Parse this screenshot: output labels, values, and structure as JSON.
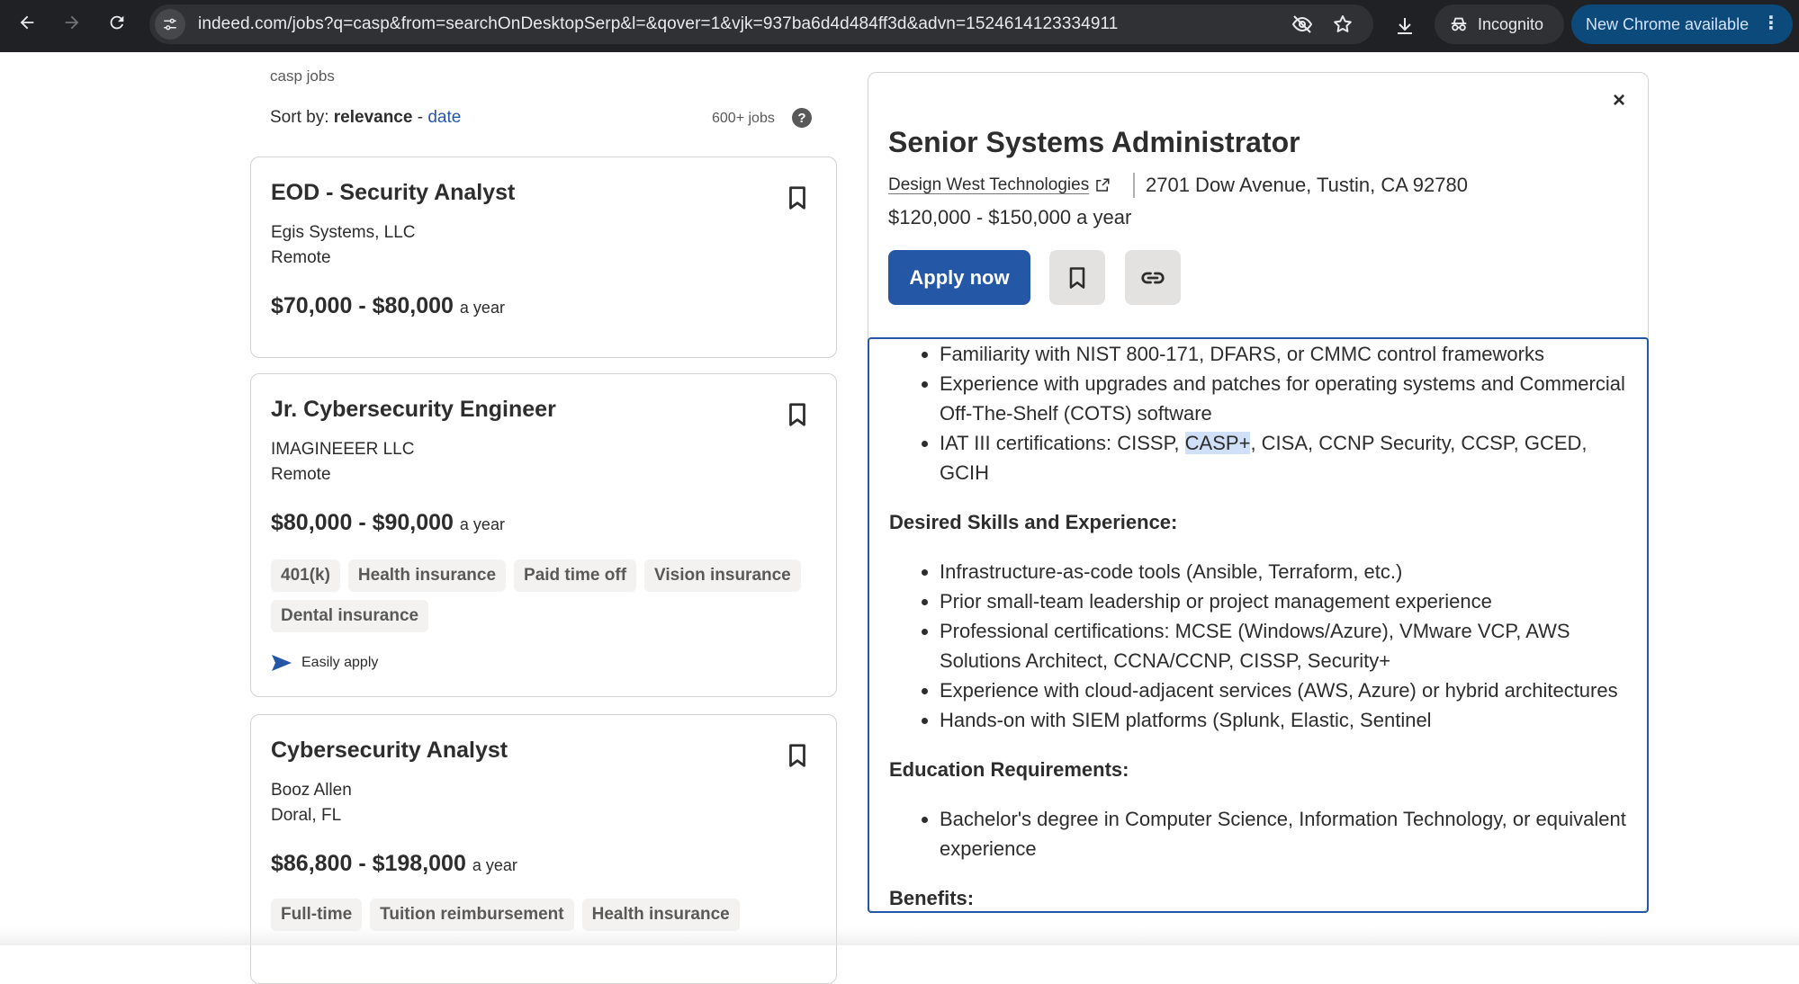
{
  "browser": {
    "url": "indeed.com/jobs?q=casp&from=searchOnDesktopSerp&l=&qover=1&vjk=937ba6d4d484ff3d&advn=1524614123334911",
    "incognito_label": "Incognito",
    "update_label": "New Chrome available",
    "colors": {
      "toolbar": "#202124",
      "omnibox": "#303134",
      "update_pill": "#0b4a7a"
    }
  },
  "search": {
    "breadcrumb": "casp jobs",
    "sort_prefix": "Sort by:",
    "sort_active": "relevance",
    "sort_separator": " - ",
    "sort_alt": "date",
    "job_count": "600+ jobs",
    "help_glyph": "?"
  },
  "jobs": [
    {
      "title": "EOD - Security Analyst",
      "company": "Egis Systems, LLC",
      "location": "Remote",
      "salary": "$70,000 - $80,000",
      "salary_period": "a year",
      "tags": [],
      "easy_apply": ""
    },
    {
      "title": "Jr. Cybersecurity Engineer",
      "company": "IMAGINEEER LLC",
      "location": "Remote",
      "salary": "$80,000 - $90,000",
      "salary_period": "a year",
      "tags": [
        "401(k)",
        "Health insurance",
        "Paid time off",
        "Vision insurance",
        "Dental insurance"
      ],
      "easy_apply": "Easily apply"
    },
    {
      "title": "Cybersecurity Analyst",
      "company": "Booz Allen",
      "location": "Doral, FL",
      "salary": "$86,800 - $198,000",
      "salary_period": "a year",
      "tags": [
        "Full-time",
        "Tuition reimbursement",
        "Health insurance"
      ],
      "easy_apply": ""
    }
  ],
  "detail": {
    "close_glyph": "×",
    "title": "Senior Systems Administrator",
    "company": "Design West Technologies",
    "address": "2701 Dow Avenue, Tustin, CA 92780",
    "salary": "$120,000 - $150,000 a year",
    "apply_label": "Apply now",
    "brand_color": "#2557a7",
    "req_bullets": [
      "Familiarity with NIST 800-171, DFARS, or CMMC control frameworks",
      "Experience with upgrades and patches for operating systems and Commercial Off-The-Shelf (COTS) software"
    ],
    "cert_prefix": "IAT III certifications: CISSP, ",
    "cert_highlight": "CASP+",
    "cert_suffix": ", CISA, CCNP Security, CCSP, GCED, GCIH",
    "desired_heading": "Desired Skills and Experience:",
    "desired_bullets": [
      "Infrastructure-as-code tools (Ansible, Terraform, etc.)",
      "Prior small-team leadership or project management experience",
      "Professional certifications: MCSE (Windows/Azure), VMware VCP, AWS Solutions Architect, CCNA/CCNP, CISSP, Security+",
      "Experience with cloud-adjacent services (AWS, Azure) or hybrid architectures",
      "Hands-on with SIEM platforms (Splunk, Elastic, Sentinel"
    ],
    "education_heading": "Education Requirements:",
    "education_bullets": [
      "Bachelor's degree in Computer Science, Information Technology, or equivalent experience"
    ],
    "benefits_heading": "Benefits:"
  }
}
